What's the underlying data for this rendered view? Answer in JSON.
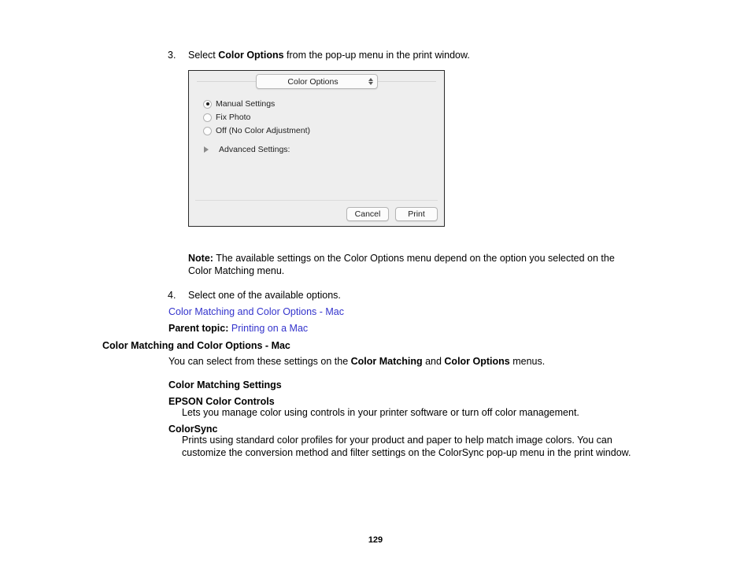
{
  "page": {
    "number": "129"
  },
  "step3": {
    "number": "3.",
    "text_before": "Select ",
    "bold": "Color Options",
    "text_after": " from the pop-up menu in the print window."
  },
  "figure": {
    "popup": {
      "label": "Color Options",
      "stepper_icon": "up-down-chevron-icon"
    },
    "options": [
      {
        "label": "Manual Settings",
        "selected": true
      },
      {
        "label": "Fix Photo",
        "selected": false
      },
      {
        "label": "Off (No Color Adjustment)",
        "selected": false
      }
    ],
    "disclosure": {
      "icon": "disclosure-triangle-icon",
      "label": "Advanced Settings:"
    },
    "buttons": {
      "cancel": "Cancel",
      "print": "Print"
    }
  },
  "note": {
    "label": "Note:",
    "text": " The available settings on the Color Options menu depend on the option you selected on the Color Matching menu."
  },
  "step4": {
    "number": "4.",
    "text": "Select one of the available options."
  },
  "links": {
    "color_matching_options_mac": "Color Matching and Color Options - Mac",
    "printing_on_a_mac": "Printing on a Mac"
  },
  "parent_topic": {
    "label": "Parent topic:",
    "spacer": " "
  },
  "section": {
    "heading": "Color Matching and Color Options - Mac",
    "intro_a": "You can select from these settings on the ",
    "intro_b": "Color Matching",
    "intro_c": " and ",
    "intro_d": "Color Options",
    "intro_e": " menus.",
    "subheading": "Color Matching Settings",
    "definitions": [
      {
        "term": "EPSON Color Controls",
        "desc": "Lets you manage color using controls in your printer software or turn off color management."
      },
      {
        "term": "ColorSync",
        "desc": "Prints using standard color profiles for your product and paper to help match image colors. You can customize the conversion method and filter settings on the ColorSync pop-up menu in the print window."
      }
    ]
  },
  "colors": {
    "link": "#3333cc",
    "text": "#000000",
    "dialog_bg": "#eeeeee",
    "dialog_border": "#2b2b2b"
  }
}
